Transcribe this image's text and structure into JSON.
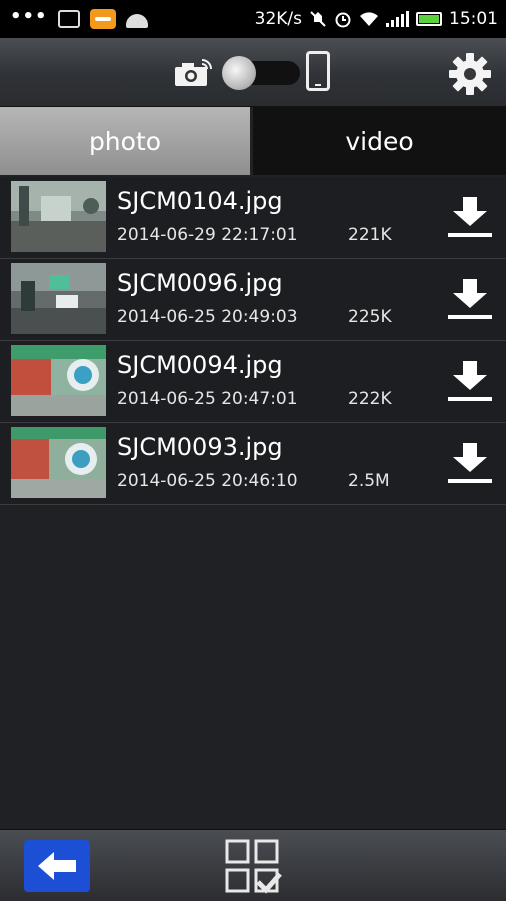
{
  "status_bar": {
    "more_icon": "ellipsis-icon",
    "speed": "32K/s",
    "time": "15:01",
    "battery_color": "#5dd241"
  },
  "toolbar": {
    "camera_icon": "camera-wifi-icon",
    "mode_toggle": "camera-phone-toggle",
    "phone_icon": "phone-icon",
    "settings_icon": "gear-icon"
  },
  "tabs": [
    {
      "label": "photo",
      "selected": true
    },
    {
      "label": "video",
      "selected": false
    }
  ],
  "files": [
    {
      "name": "SJCM0104.jpg",
      "date": "2014-06-29 22:17:01",
      "size": "221K"
    },
    {
      "name": "SJCM0096.jpg",
      "date": "2014-06-25 20:49:03",
      "size": "225K"
    },
    {
      "name": "SJCM0094.jpg",
      "date": "2014-06-25 20:47:01",
      "size": "222K"
    },
    {
      "name": "SJCM0093.jpg",
      "date": "2014-06-25 20:46:10",
      "size": "2.5M"
    }
  ],
  "bottom_bar": {
    "back_icon": "arrow-left-icon",
    "select_icon": "grid-select-icon",
    "back_color": "#1d4fd6"
  }
}
